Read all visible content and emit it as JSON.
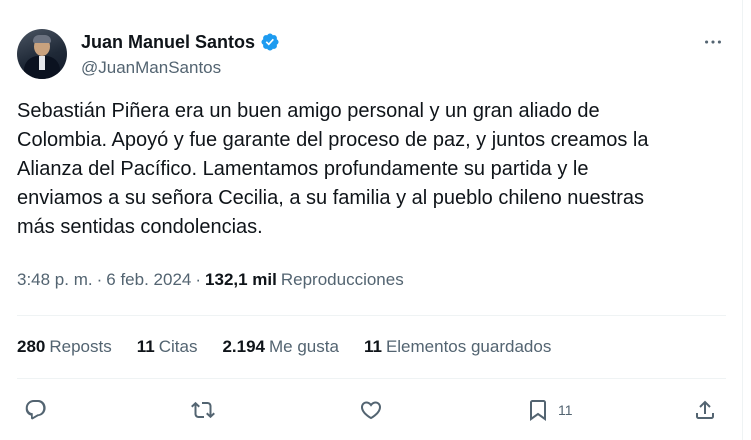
{
  "author": {
    "display_name": "Juan Manuel Santos",
    "handle": "@JuanManSantos",
    "verified_icon": "verified-badge-icon",
    "verified_color": "#1d9bf0"
  },
  "tweet": {
    "text": "Sebastián Piñera era un buen amigo personal y un gran aliado de\nColombia. Apoyó y fue garante del proceso de paz, y juntos creamos la\nAlianza del Pacífico. Lamentamos profundamente su partida y le\nenviamos a su señora Cecilia, a su familia y al pueblo chileno nuestras\nmás sentidas condolencias.",
    "time": "3:48 p. m.",
    "separator": "·",
    "date": "6 feb. 2024",
    "views_count": "132,1 mil",
    "views_label": "Reproducciones"
  },
  "stats": [
    {
      "count": "280",
      "label": "Reposts"
    },
    {
      "count": "11",
      "label": "Citas"
    },
    {
      "count": "2.194",
      "label": "Me gusta"
    },
    {
      "count": "11",
      "label": "Elementos guardados"
    }
  ],
  "actions": {
    "reply_icon": "reply-icon",
    "repost_icon": "repost-icon",
    "like_icon": "heart-icon",
    "bookmark_icon": "bookmark-icon",
    "bookmark_count": "11",
    "share_icon": "share-icon",
    "icon_color": "#536471"
  },
  "colors": {
    "text_primary": "#0f1419",
    "text_secondary": "#536471",
    "divider": "#eff3f4",
    "accent": "#1d9bf0"
  }
}
